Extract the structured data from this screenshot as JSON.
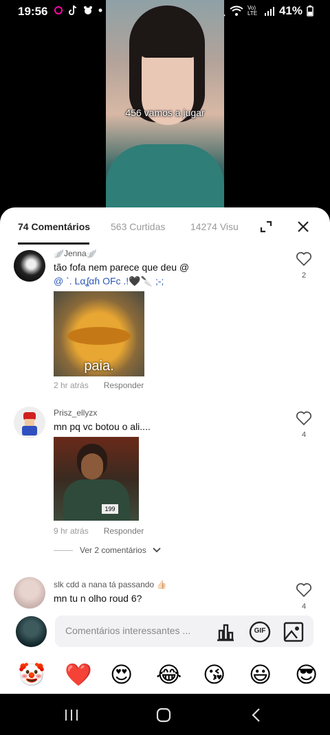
{
  "status": {
    "time": "19:56",
    "battery": "41%",
    "volte": "Vo) LTE"
  },
  "video": {
    "caption": "456 vamos a jugar"
  },
  "tabs": {
    "comments": "74 Comentários",
    "likes": "563 Curtidas",
    "views": "14274 Visu"
  },
  "comments": [
    {
      "user": "Jenna",
      "text1": "tão fofa nem parece que deu @",
      "text2": "@ `. Lαʆαɦ OFc .!🖤🔪 ;-;",
      "image_caption": "paia.",
      "time": "2 hr atrás",
      "reply": "Responder",
      "likes": "2"
    },
    {
      "user": "Prisz_ellyzx",
      "text1": "mn pq vc botou o ali....",
      "image_caption": "199",
      "time": "9 hr atrás",
      "reply": "Responder",
      "likes": "4",
      "more": "Ver 2 comentários"
    },
    {
      "user": "slk cdd a nana tá passando 👍🏻",
      "text1": "mn tu n olho roud 6?",
      "likes": "4"
    }
  ],
  "composer": {
    "placeholder": "Comentários interessantes ...",
    "gif_label": "GIF"
  },
  "emojis": [
    "🤡",
    "❤️",
    "😍",
    "😂",
    "😘",
    "😃",
    "😎"
  ],
  "colors": {
    "heart": "#e0141e",
    "accent": "#111111"
  }
}
